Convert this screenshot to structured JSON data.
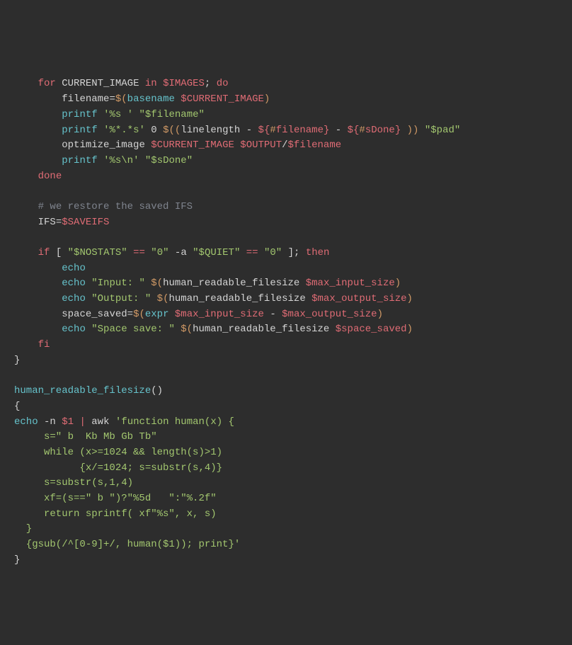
{
  "code": {
    "l1": {
      "for": "for",
      "var": "CURRENT_IMAGE",
      "in": "in",
      "images": "$IMAGES",
      "do": "do"
    },
    "l2": {
      "filename": "filename",
      "eq": "=",
      "basename": "basename",
      "ci": "$CURRENT_IMAGE"
    },
    "l3": {
      "printf": "printf",
      "fmt": "'%s '",
      "arg": "\"$filename\""
    },
    "l4": {
      "printf": "printf",
      "fmt": "'%*.*s'",
      "zero": "0",
      "ll": "linelength",
      "fn": "filename",
      "sd": "sDone",
      "pad": "\"$pad\""
    },
    "l5": {
      "oi": "optimize_image",
      "ci": "$CURRENT_IMAGE",
      "out": "$OUTPUT",
      "slash": "/",
      "fn": "$filename"
    },
    "l6": {
      "printf": "printf",
      "fmt": "'%s\\n'",
      "arg": "\"$sDone\""
    },
    "l7": {
      "done": "done"
    },
    "l8": {
      "comment": "# we restore the saved IFS"
    },
    "l9": {
      "ifs": "IFS",
      "eq": "=",
      "sv": "$SAVEIFS"
    },
    "l10": {
      "if": "if",
      "ns": "\"$NOSTATS\"",
      "eq": "==",
      "z1": "\"0\"",
      "a": "-a",
      "q": "\"$QUIET\"",
      "z2": "\"0\"",
      "then": "then"
    },
    "l11": {
      "echo": "echo"
    },
    "l12": {
      "echo": "echo",
      "s": "\"Input: \"",
      "hrf": "human_readable_filesize",
      "v": "$max_input_size"
    },
    "l13": {
      "echo": "echo",
      "s": "\"Output: \"",
      "hrf": "human_readable_filesize",
      "v": "$max_output_size"
    },
    "l14": {
      "ss": "space_saved",
      "eq": "=",
      "expr": "expr",
      "mi": "$max_input_size",
      "minus": "-",
      "mo": "$max_output_size"
    },
    "l15": {
      "echo": "echo",
      "s": "\"Space save: \"",
      "hrf": "human_readable_filesize",
      "v": "$space_saved"
    },
    "l16": {
      "fi": "fi"
    },
    "l17": {
      "cb": "}"
    },
    "l18": {
      "fn": "human_readable_filesize",
      "p": "()"
    },
    "l19": {
      "ob": "{"
    },
    "l20": {
      "echo": "echo",
      "n": "-n",
      "d1": "$1",
      "pipe": "|",
      "awk": "awk",
      "s": "'function human(x) {"
    },
    "l21": {
      "s": "     s=\" b  Kb Mb Gb Tb\""
    },
    "l22": {
      "s": "     while (x>=1024 && length(s)>1)"
    },
    "l23": {
      "s": "           {x/=1024; s=substr(s,4)}"
    },
    "l24": {
      "s": "     s=substr(s,1,4)"
    },
    "l25": {
      "s": "     xf=(s==\" b \")?\"%5d   \":\"%.2f\""
    },
    "l26": {
      "s": "     return sprintf( xf\"%s\", x, s)"
    },
    "l27": {
      "s": "  }"
    },
    "l28": {
      "s": "  {gsub(/^[0-9]+/, human($1)); print}'"
    },
    "l29": {
      "cb": "}"
    }
  }
}
